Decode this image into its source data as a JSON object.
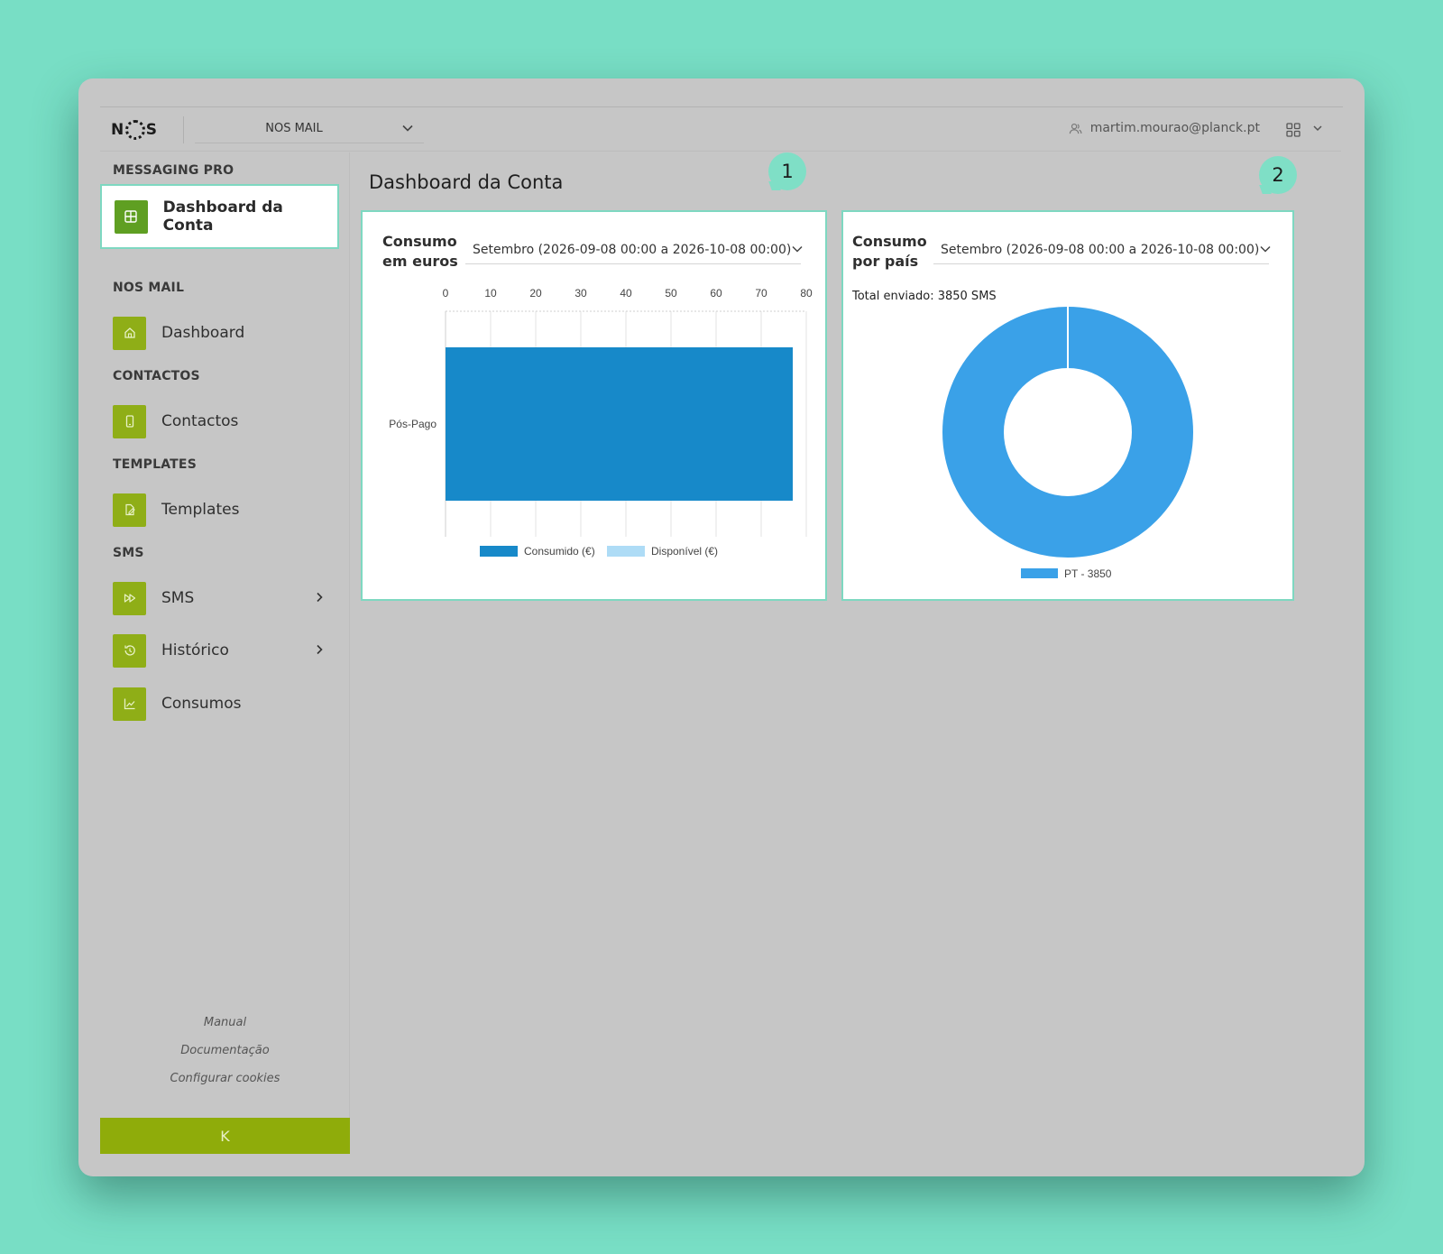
{
  "header": {
    "logo_left": "N",
    "logo_right": "S",
    "product": "NOS MAIL",
    "user_email": "martim.mourao@planck.pt"
  },
  "sidebar": {
    "sections": [
      {
        "title": "MESSAGING PRO",
        "items": [
          {
            "label": "Dashboard da Conta",
            "icon": "table-icon",
            "active": true
          }
        ]
      },
      {
        "title": "NOS MAIL",
        "items": [
          {
            "label": "Dashboard",
            "icon": "home-icon"
          }
        ]
      },
      {
        "title": "CONTACTOS",
        "items": [
          {
            "label": "Contactos",
            "icon": "phone-icon"
          }
        ]
      },
      {
        "title": "TEMPLATES",
        "items": [
          {
            "label": "Templates",
            "icon": "edit-icon"
          }
        ]
      },
      {
        "title": "SMS",
        "items": [
          {
            "label": "SMS",
            "icon": "fast-forward-icon",
            "expandable": true
          },
          {
            "label": "Histórico",
            "icon": "history-icon",
            "expandable": true
          },
          {
            "label": "Consumos",
            "icon": "chart-icon"
          }
        ]
      }
    ],
    "footer_links": [
      "Manual",
      "Documentação",
      "Configurar cookies"
    ],
    "collapse_label": "K"
  },
  "main": {
    "page_title": "Dashboard da Conta",
    "badges": [
      "1",
      "2"
    ],
    "cards": [
      {
        "title": "Consumo em euros",
        "period": "Setembro (2026-09-08 00:00 a 2026-10-08 00:00)"
      },
      {
        "title": "Consumo por país",
        "period": "Setembro (2026-09-08 00:00 a 2026-10-08 00:00)",
        "total_sent": "Total enviado: 3850 SMS"
      }
    ]
  },
  "colors": {
    "accent_green": "#8fae17",
    "active_green": "#5f9f22",
    "highlight_teal": "#7ed8c1",
    "bar_consumed": "#1789c9",
    "bar_available": "#aedcf6",
    "donut_pt": "#3aa1e8"
  },
  "chart_data": [
    {
      "type": "bar",
      "orientation": "horizontal",
      "categories": [
        "Pós-Pago"
      ],
      "series": [
        {
          "name": "Consumido (€)",
          "values": [
            77
          ]
        },
        {
          "name": "Disponível (€)",
          "values": [
            0
          ]
        }
      ],
      "xlim": [
        0,
        80
      ],
      "x_ticks": [
        "0",
        "10",
        "20",
        "30",
        "40",
        "50",
        "60",
        "70",
        "80"
      ],
      "x_axis_position": "top",
      "grid": true,
      "legend": "bottom"
    },
    {
      "type": "pie",
      "variant": "donut",
      "categories": [
        "PT"
      ],
      "values": [
        3850
      ],
      "legend_labels": [
        "PT - 3850"
      ],
      "legend": "bottom"
    }
  ]
}
